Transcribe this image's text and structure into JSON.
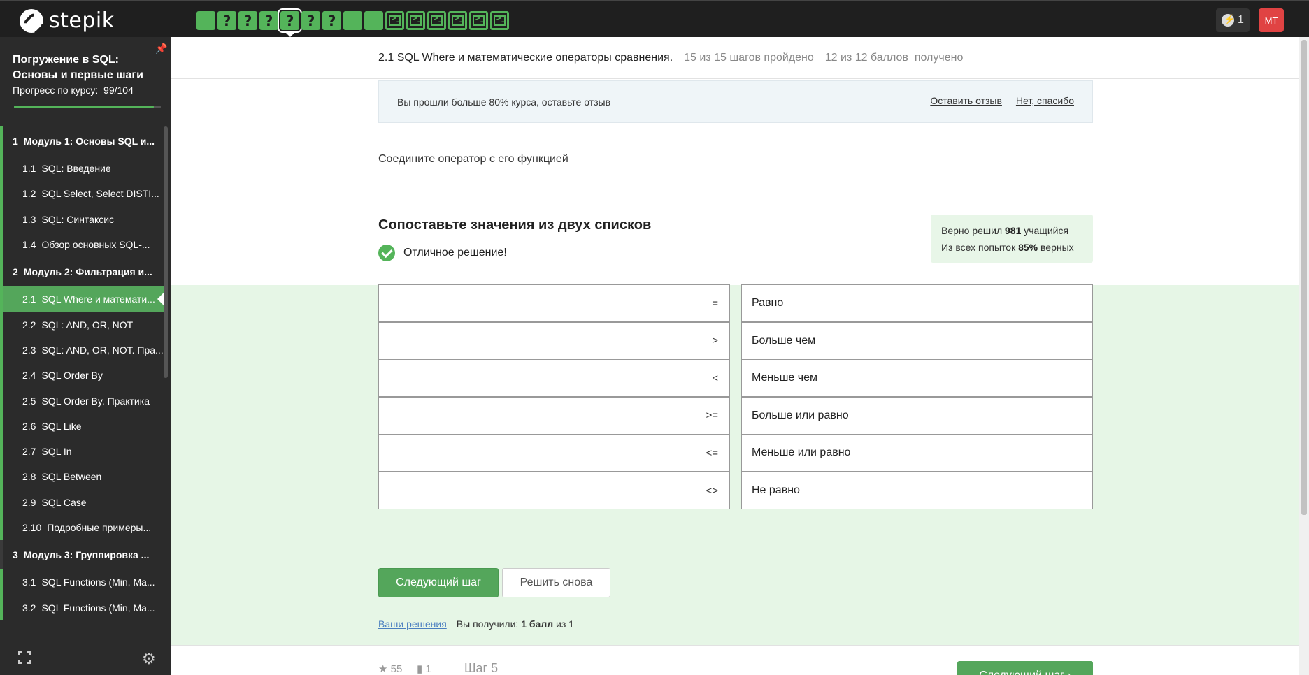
{
  "brand": {
    "name": "stepik"
  },
  "topbar": {
    "steps": [
      {
        "type": "done"
      },
      {
        "type": "quiz",
        "label": "?"
      },
      {
        "type": "quiz",
        "label": "?"
      },
      {
        "type": "quiz",
        "label": "?"
      },
      {
        "type": "quiz",
        "label": "?",
        "current": true
      },
      {
        "type": "quiz",
        "label": "?"
      },
      {
        "type": "quiz",
        "label": "?"
      },
      {
        "type": "done"
      },
      {
        "type": "done"
      },
      {
        "type": "code"
      },
      {
        "type": "code"
      },
      {
        "type": "code"
      },
      {
        "type": "code"
      },
      {
        "type": "code"
      },
      {
        "type": "code"
      }
    ],
    "streak_count": "1",
    "avatar_initials": "МТ"
  },
  "sidebar": {
    "course_title": "Погружение в SQL: Основы и первые шаги",
    "progress_label": "Прогресс по курсу:",
    "progress_value": "99/104",
    "progress_fraction": 0.952,
    "items": [
      {
        "kind": "module",
        "num": "1",
        "label": "Модуль 1: Основы SQL и..."
      },
      {
        "kind": "lesson",
        "num": "1.1",
        "label": "SQL: Введение"
      },
      {
        "kind": "lesson",
        "num": "1.2",
        "label": "SQL Select, Select DISTI..."
      },
      {
        "kind": "lesson",
        "num": "1.3",
        "label": "SQL: Синтаксис"
      },
      {
        "kind": "lesson",
        "num": "1.4",
        "label": "Обзор основных SQL-..."
      },
      {
        "kind": "module",
        "num": "2",
        "label": "Модуль 2: Фильтрация и..."
      },
      {
        "kind": "lesson",
        "num": "2.1",
        "label": "SQL Where и математи...",
        "active": true
      },
      {
        "kind": "lesson",
        "num": "2.2",
        "label": "SQL: AND, OR, NOT"
      },
      {
        "kind": "lesson",
        "num": "2.3",
        "label": "SQL: AND, OR, NOT. Пра..."
      },
      {
        "kind": "lesson",
        "num": "2.4",
        "label": "SQL Order By"
      },
      {
        "kind": "lesson",
        "num": "2.5",
        "label": "SQL Order By. Практика"
      },
      {
        "kind": "lesson",
        "num": "2.6",
        "label": "SQL Like"
      },
      {
        "kind": "lesson",
        "num": "2.7",
        "label": "SQL In"
      },
      {
        "kind": "lesson",
        "num": "2.8",
        "label": "SQL Between"
      },
      {
        "kind": "lesson",
        "num": "2.9",
        "label": "SQL Case"
      },
      {
        "kind": "lesson",
        "num": "2.10",
        "label": "Подробные примеры..."
      },
      {
        "kind": "module",
        "num": "3",
        "label": "Модуль 3: Группировка ...",
        "nomark": true
      },
      {
        "kind": "lesson",
        "num": "3.1",
        "label": "SQL Functions (Min, Ma..."
      },
      {
        "kind": "lesson",
        "num": "3.2",
        "label": "SQL Functions (Min, Ma..."
      }
    ]
  },
  "lesson": {
    "title": "2.1 SQL Where и математические операторы сравнения.",
    "steps_passed": "15 из 15 шагов пройдено",
    "points": "12 из 12 баллов  получено"
  },
  "review": {
    "text": "Вы прошли больше 80% курса, оставьте отзыв",
    "leave_label": "Оставить отзыв",
    "decline_label": "Нет, спасибо"
  },
  "task": {
    "text": "Соедините оператор с его функцией",
    "heading": "Сопоставьте значения из двух списков",
    "result": "Отличное решение!",
    "stats_line1_prefix": "Верно решил",
    "stats_solved": "981",
    "stats_line1_suffix": "учащийся",
    "stats_line2_prefix": "Из всех попыток",
    "stats_percent": "85%",
    "stats_line2_suffix": "верных",
    "pairs": [
      {
        "left": "=",
        "right": "Равно"
      },
      {
        "left": ">",
        "right": "Больше чем"
      },
      {
        "left": "<",
        "right": "Меньше чем"
      },
      {
        "left": ">=",
        "right": "Больше или равно"
      },
      {
        "left": "<=",
        "right": "Меньше или равно"
      },
      {
        "left": "<>",
        "right": "Не равно"
      }
    ],
    "next_label": "Следующий шаг",
    "retry_label": "Решить снова",
    "solutions_link": "Ваши решения",
    "score_prefix": "Вы получили:",
    "score_value": "1 балл",
    "score_suffix": "из 1"
  },
  "footer": {
    "likes": "55",
    "comments": "1",
    "step_label": "Шаг 5",
    "next_label": "Следующий шаг"
  },
  "colors": {
    "accent": "#54b45a",
    "topbar": "#1f1f1f",
    "sidebar": "#2b2b2b",
    "success_bg": "#e6f6e6",
    "avatar": "#e04343"
  }
}
